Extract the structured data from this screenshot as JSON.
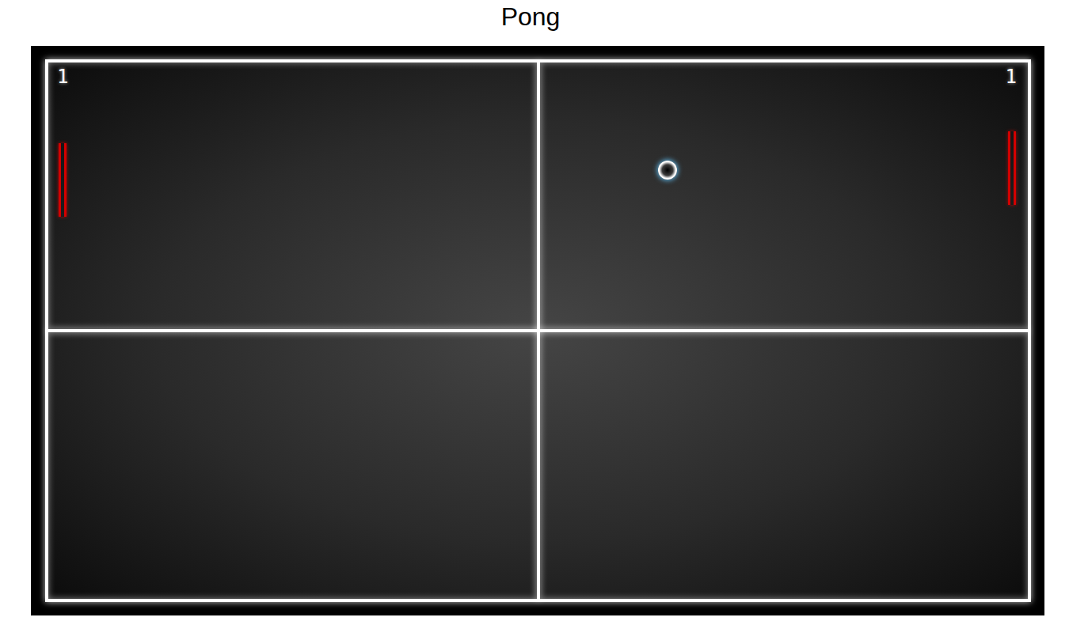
{
  "window": {
    "title": "Pong"
  },
  "players": [
    {
      "score": "1"
    },
    {
      "score": "1"
    }
  ]
}
